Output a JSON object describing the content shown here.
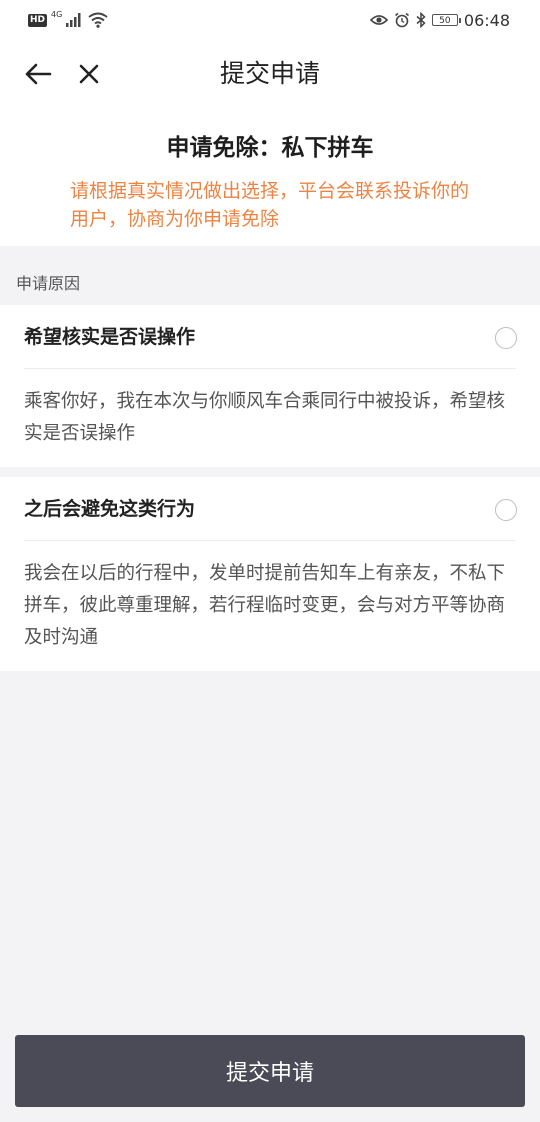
{
  "status_bar": {
    "hd": "HD",
    "network": "4G",
    "battery": "50",
    "time": "06:48"
  },
  "nav": {
    "title": "提交申请"
  },
  "header": {
    "title": "申请免除：私下拼车",
    "notice": "请根据真实情况做出选择，平台会联系投诉你的用户，协商为你申请免除"
  },
  "section": {
    "label": "申请原因"
  },
  "options": [
    {
      "title": "希望核实是否误操作",
      "description": "乘客你好，我在本次与你顺风车合乘同行中被投诉，希望核实是否误操作"
    },
    {
      "title": "之后会避免这类行为",
      "description": "我会在以后的行程中，发单时提前告知车上有亲友，不私下拼车，彼此尊重理解，若行程临时变更，会与对方平等协商及时沟通"
    }
  ],
  "submit": {
    "label": "提交申请"
  },
  "colors": {
    "notice": "#ee8443",
    "button": "#4b4b58",
    "background": "#f3f3f5"
  },
  "icons": [
    "hd-icon",
    "signal-icon",
    "wifi-icon",
    "eye-icon",
    "alarm-icon",
    "bluetooth-icon",
    "battery-icon",
    "back-arrow-icon",
    "close-icon",
    "radio-icon"
  ]
}
